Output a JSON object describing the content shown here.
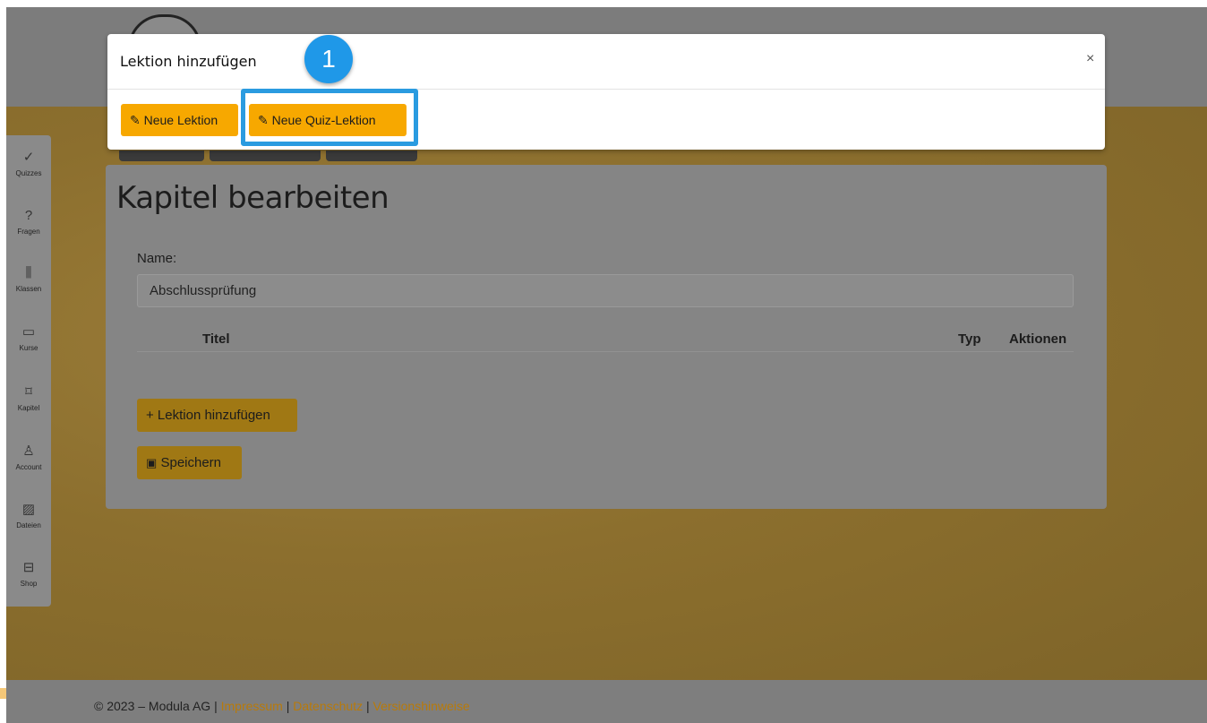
{
  "sidebar": {
    "items": [
      {
        "icon": "✓",
        "label": "Quizzes"
      },
      {
        "icon": "?",
        "label": "Fragen"
      },
      {
        "icon": "⫼",
        "label": "Klassen"
      },
      {
        "icon": "▭",
        "label": "Kurse"
      },
      {
        "icon": "⌑",
        "label": "Kapitel"
      },
      {
        "icon": "♙",
        "label": "Account"
      },
      {
        "icon": "▨",
        "label": "Dateien"
      },
      {
        "icon": "⊟",
        "label": "Shop"
      }
    ]
  },
  "page": {
    "title": "Kapitel bearbeiten",
    "name_label": "Name:",
    "name_value": "Abschlussprüfung",
    "table": {
      "columns": [
        "Titel",
        "Typ",
        "Aktionen"
      ]
    },
    "add_lesson_label": "+ Lektion hinzufügen",
    "save_label": "Speichern"
  },
  "modal": {
    "title": "Lektion hinzufügen",
    "close": "×",
    "new_lesson_label": "Neue Lektion",
    "new_quiz_lesson_label": "Neue Quiz-Lektion",
    "step_badge": "1"
  },
  "footer": {
    "copyright": "© 2023 – Modula AG",
    "sep": "|",
    "links": [
      "Impressum",
      "Datenschutz",
      "Versionshinweise"
    ]
  },
  "colors": {
    "accent": "#f7a800",
    "highlight": "#2a9be0",
    "badge": "#1f98e8"
  }
}
